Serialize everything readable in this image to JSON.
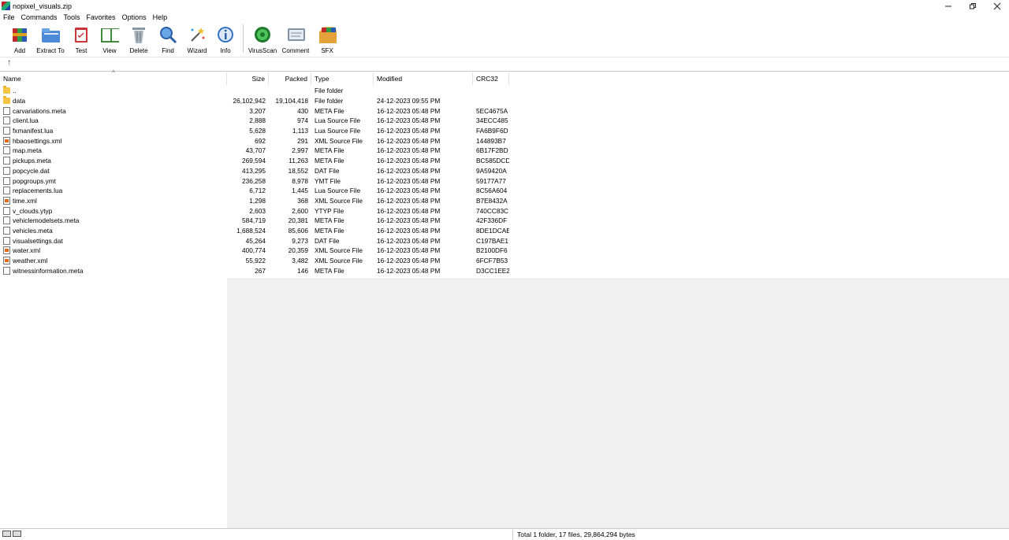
{
  "window": {
    "title": "nopixel_visuals.zip"
  },
  "menu": [
    "File",
    "Commands",
    "Tools",
    "Favorites",
    "Options",
    "Help"
  ],
  "toolbar": [
    {
      "label": "Add",
      "icon": "add-archive-icon"
    },
    {
      "label": "Extract To",
      "icon": "extract-folder-icon"
    },
    {
      "label": "Test",
      "icon": "test-clipboard-icon"
    },
    {
      "label": "View",
      "icon": "view-book-icon"
    },
    {
      "label": "Delete",
      "icon": "trash-icon"
    },
    {
      "label": "Find",
      "icon": "magnifier-icon"
    },
    {
      "label": "Wizard",
      "icon": "magic-wand-icon"
    },
    {
      "label": "Info",
      "icon": "info-icon"
    },
    {
      "label": "VirusScan",
      "icon": "virus-scan-icon"
    },
    {
      "label": "Comment",
      "icon": "comment-icon"
    },
    {
      "label": "SFX",
      "icon": "sfx-box-icon"
    }
  ],
  "address": {
    "up_symbol": "↑"
  },
  "columns": {
    "name": "Name",
    "size": "Size",
    "packed": "Packed",
    "type": "Type",
    "modified": "Modified",
    "crc": "CRC32",
    "sort_indicator": "^"
  },
  "files": [
    {
      "name": "..",
      "size": "",
      "packed": "",
      "type": "File folder",
      "modified": "",
      "crc": "",
      "icon": "folder"
    },
    {
      "name": "data",
      "size": "26,102,942",
      "packed": "19,104,418",
      "type": "File folder",
      "modified": "24-12-2023 09:55 PM",
      "crc": "",
      "icon": "folder"
    },
    {
      "name": "carvariations.meta",
      "size": "3,207",
      "packed": "430",
      "type": "META File",
      "modified": "16-12-2023 05:48 PM",
      "crc": "5EC4675A",
      "icon": "doc"
    },
    {
      "name": "client.lua",
      "size": "2,888",
      "packed": "974",
      "type": "Lua Source File",
      "modified": "16-12-2023 05:48 PM",
      "crc": "34ECC485",
      "icon": "doc"
    },
    {
      "name": "fxmanifest.lua",
      "size": "5,628",
      "packed": "1,113",
      "type": "Lua Source File",
      "modified": "16-12-2023 05:48 PM",
      "crc": "FA6B9F6D",
      "icon": "doc"
    },
    {
      "name": "hbaosettings.xml",
      "size": "692",
      "packed": "291",
      "type": "XML Source File",
      "modified": "16-12-2023 05:48 PM",
      "crc": "144893B7",
      "icon": "xml"
    },
    {
      "name": "map.meta",
      "size": "43,707",
      "packed": "2,997",
      "type": "META File",
      "modified": "16-12-2023 05:48 PM",
      "crc": "6B17F2BD",
      "icon": "doc"
    },
    {
      "name": "pickups.meta",
      "size": "269,594",
      "packed": "11,263",
      "type": "META File",
      "modified": "16-12-2023 05:48 PM",
      "crc": "BC585DCD",
      "icon": "doc"
    },
    {
      "name": "popcycle.dat",
      "size": "413,295",
      "packed": "18,552",
      "type": "DAT File",
      "modified": "16-12-2023 05:48 PM",
      "crc": "9A59420A",
      "icon": "doc"
    },
    {
      "name": "popgroups.ymt",
      "size": "236,258",
      "packed": "8,978",
      "type": "YMT File",
      "modified": "16-12-2023 05:48 PM",
      "crc": "59177A77",
      "icon": "doc"
    },
    {
      "name": "replacements.lua",
      "size": "6,712",
      "packed": "1,445",
      "type": "Lua Source File",
      "modified": "16-12-2023 05:48 PM",
      "crc": "8C56A604",
      "icon": "doc"
    },
    {
      "name": "time.xml",
      "size": "1,298",
      "packed": "368",
      "type": "XML Source File",
      "modified": "16-12-2023 05:48 PM",
      "crc": "B7E8432A",
      "icon": "xml"
    },
    {
      "name": "v_clouds.ytyp",
      "size": "2,603",
      "packed": "2,600",
      "type": "YTYP File",
      "modified": "16-12-2023 05:48 PM",
      "crc": "740CC83C",
      "icon": "doc"
    },
    {
      "name": "vehiclemodelsets.meta",
      "size": "584,719",
      "packed": "20,381",
      "type": "META File",
      "modified": "16-12-2023 05:48 PM",
      "crc": "42F336DF",
      "icon": "doc"
    },
    {
      "name": "vehicles.meta",
      "size": "1,688,524",
      "packed": "85,606",
      "type": "META File",
      "modified": "16-12-2023 05:48 PM",
      "crc": "8DE1DCAE",
      "icon": "doc"
    },
    {
      "name": "visualsettings.dat",
      "size": "45,264",
      "packed": "9,273",
      "type": "DAT File",
      "modified": "16-12-2023 05:48 PM",
      "crc": "C197BAE1",
      "icon": "doc"
    },
    {
      "name": "water.xml",
      "size": "400,774",
      "packed": "20,359",
      "type": "XML Source File",
      "modified": "16-12-2023 05:48 PM",
      "crc": "B2100DF6",
      "icon": "xml"
    },
    {
      "name": "weather.xml",
      "size": "55,922",
      "packed": "3,482",
      "type": "XML Source File",
      "modified": "16-12-2023 05:48 PM",
      "crc": "6FCF7B53",
      "icon": "xml"
    },
    {
      "name": "witnessinformation.meta",
      "size": "267",
      "packed": "146",
      "type": "META File",
      "modified": "16-12-2023 05:48 PM",
      "crc": "D3CC1EE2",
      "icon": "doc"
    }
  ],
  "status": {
    "summary": "Total 1 folder, 17 files, 29,864,294 bytes"
  }
}
